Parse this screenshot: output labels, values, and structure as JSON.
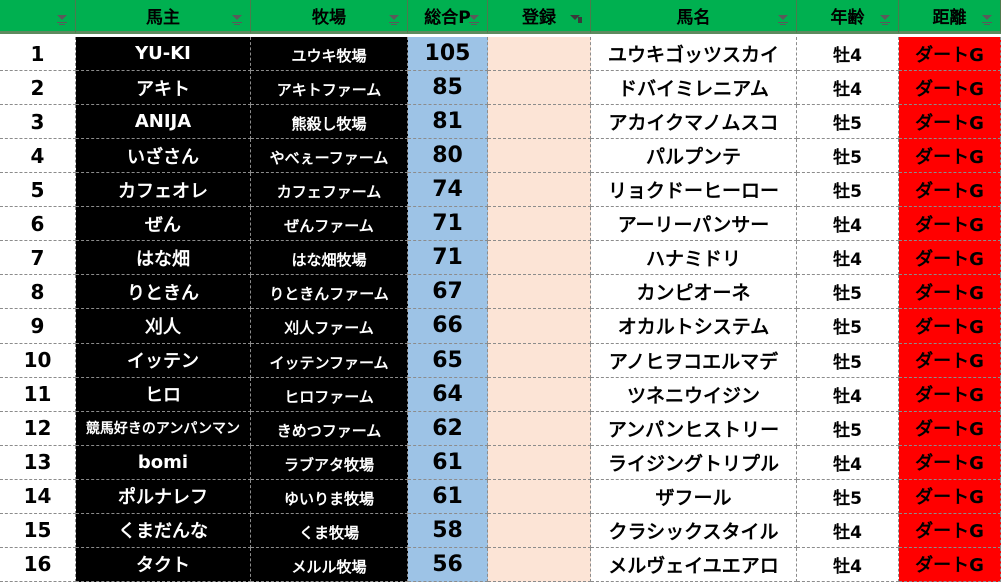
{
  "header": {
    "no": "",
    "owner": "馬主",
    "farm": "牧場",
    "points": "総合P",
    "register": "登録",
    "horse": "馬名",
    "age": "年齢",
    "distance": "距離"
  },
  "rows": [
    {
      "no": "1",
      "owner": "YU-KI",
      "farm": "ユウキ牧場",
      "points": "105",
      "register": "",
      "horse": "ユウキゴッツスカイ",
      "age": "牡4",
      "distance": "ダートG"
    },
    {
      "no": "2",
      "owner": "アキト",
      "farm": "アキトファーム",
      "points": "85",
      "register": "",
      "horse": "ドバイミレニアム",
      "age": "牡4",
      "distance": "ダートG"
    },
    {
      "no": "3",
      "owner": "ANIJA",
      "farm": "熊殺し牧場",
      "points": "81",
      "register": "",
      "horse": "アカイクマノムスコ",
      "age": "牡5",
      "distance": "ダートG"
    },
    {
      "no": "4",
      "owner": "いざさん",
      "farm": "やべぇーファーム",
      "points": "80",
      "register": "",
      "horse": "パルプンテ",
      "age": "牡5",
      "distance": "ダートG"
    },
    {
      "no": "5",
      "owner": "カフェオレ",
      "farm": "カフェファーム",
      "points": "74",
      "register": "",
      "horse": "リョクドーヒーロー",
      "age": "牡5",
      "distance": "ダートG"
    },
    {
      "no": "6",
      "owner": "ぜん",
      "farm": "ぜんファーム",
      "points": "71",
      "register": "",
      "horse": "アーリーパンサー",
      "age": "牡4",
      "distance": "ダートG"
    },
    {
      "no": "7",
      "owner": "はな畑",
      "farm": "はな畑牧場",
      "points": "71",
      "register": "",
      "horse": "ハナミドリ",
      "age": "牡4",
      "distance": "ダートG"
    },
    {
      "no": "8",
      "owner": "りときん",
      "farm": "りときんファーム",
      "points": "67",
      "register": "",
      "horse": "カンピオーネ",
      "age": "牡5",
      "distance": "ダートG"
    },
    {
      "no": "9",
      "owner": "刈人",
      "farm": "刈人ファーム",
      "points": "66",
      "register": "",
      "horse": "オカルトシステム",
      "age": "牡5",
      "distance": "ダートG"
    },
    {
      "no": "10",
      "owner": "イッテン",
      "farm": "イッテンファーム",
      "points": "65",
      "register": "",
      "horse": "アノヒヲコエルマデ",
      "age": "牡5",
      "distance": "ダートG"
    },
    {
      "no": "11",
      "owner": "ヒロ",
      "farm": "ヒロファーム",
      "points": "64",
      "register": "",
      "horse": "ツネニウイジン",
      "age": "牡4",
      "distance": "ダートG"
    },
    {
      "no": "12",
      "owner": "競馬好きのアンパンマン",
      "farm": "きめつファーム",
      "points": "62",
      "register": "",
      "horse": "アンパンヒストリー",
      "age": "牡5",
      "distance": "ダートG"
    },
    {
      "no": "13",
      "owner": "bomi",
      "farm": "ラブアタ牧場",
      "points": "61",
      "register": "",
      "horse": "ライジングトリプル",
      "age": "牡4",
      "distance": "ダートG"
    },
    {
      "no": "14",
      "owner": "ポルナレフ",
      "farm": "ゆいりま牧場",
      "points": "61",
      "register": "",
      "horse": "ザフール",
      "age": "牡5",
      "distance": "ダートG"
    },
    {
      "no": "15",
      "owner": "くまだんな",
      "farm": "くま牧場",
      "points": "58",
      "register": "",
      "horse": "クラシックスタイル",
      "age": "牡4",
      "distance": "ダートG"
    },
    {
      "no": "16",
      "owner": "タクト",
      "farm": "メルル牧場",
      "points": "56",
      "register": "",
      "horse": "メルヴェイユエアロ",
      "age": "牡4",
      "distance": "ダートG"
    }
  ],
  "colors": {
    "header_bg": "#00b050",
    "owner_bg": "#000000",
    "points_bg": "#9dc3e6",
    "register_bg": "#fce4d6",
    "distance_bg": "#ff0000"
  },
  "icons": {
    "filter": "filter-dropdown-icon",
    "filter_active": "filter-funnel-icon"
  }
}
